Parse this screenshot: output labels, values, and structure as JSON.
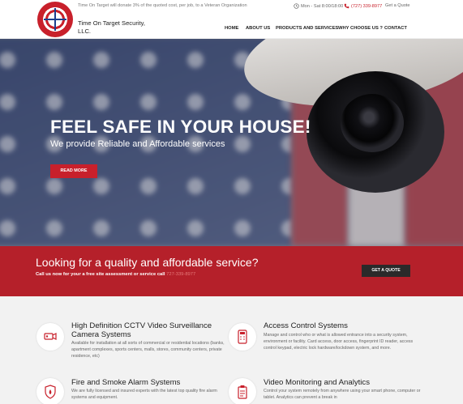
{
  "topbar": {
    "donation_text": "Time On Target will donate 3% of the quoted cost, per job, to a Veteran Organization",
    "hours": "Mon - Sat 8:00/18:00",
    "phone": "(727) 339-8977",
    "get_quote": "Get a Quote"
  },
  "brand": {
    "name": "Time On Target Security, LLC.",
    "logo_ring_text": "TIME ON TARGET"
  },
  "nav": {
    "items": [
      "HOME",
      "ABOUT US",
      "PRODUCTS AND SERVICES",
      "WHY CHOOSE US ?",
      "CONTACT"
    ]
  },
  "hero": {
    "title": "FEEL SAFE IN YOUR HOUSE!",
    "subtitle": "We provide Reliable and Affordable services",
    "button": "READ MORE"
  },
  "cta": {
    "title": "Looking for a quality and affordable service?",
    "subtitle": "Call us now for your a free site assessment or service call",
    "phone": "727-339-8977",
    "button": "GET A QUOTE"
  },
  "services": [
    {
      "icon": "cctv-camera-icon",
      "title": "High Definition CCTV Video Surveillance Camera Systems",
      "description": "Available for installation at all sorts of commercial or residential locations (banks, apartment complexes, sports centers, malls, stores, community centers, private residence, etc)"
    },
    {
      "icon": "access-control-icon",
      "title": "Access Control Systems",
      "description": "Manage and control who or what is allowed entrance into a security system, environment or facility. Card access, door access, fingerprint ID reader, access control keypad, electric lock hardware/lockdown system, and more."
    },
    {
      "icon": "fire-shield-icon",
      "title": "Fire and Smoke Alarm Systems",
      "description": "We are fully licensed and insured experts with the latest top quality fire alarm systems and equipment."
    },
    {
      "icon": "clipboard-icon",
      "title": "Video Monitoring and Analytics",
      "description": "Control your system remotely from anywhere using your smart phone, computer or tablet. Analytics can prevent a break in"
    }
  ],
  "colors": {
    "brand_red": "#c8202b",
    "cta_red": "#b5202a",
    "dark_button": "#2a2a2a"
  }
}
